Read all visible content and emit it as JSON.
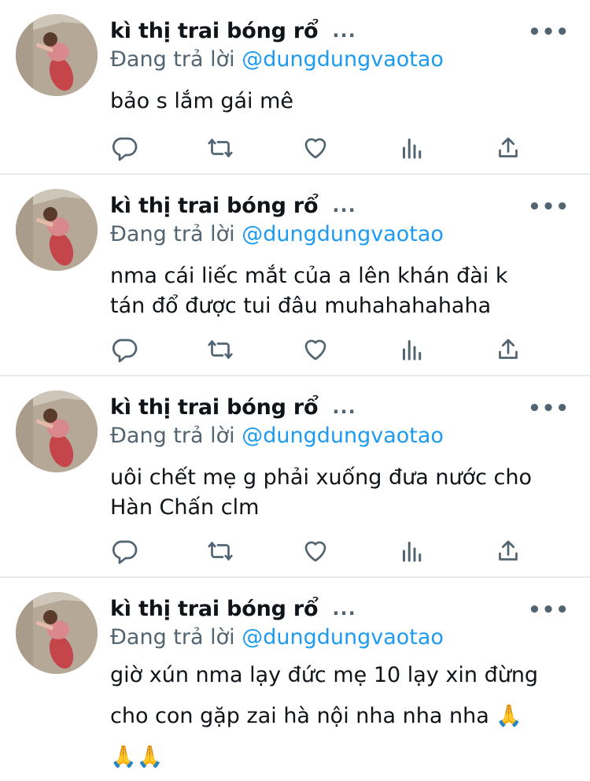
{
  "tweets": [
    {
      "name": "kì thị trai bóng rổ",
      "name_dots": "...",
      "more": "•••",
      "reply_prefix": "Đang trả lời",
      "reply_handle": "@dungdungvaotao",
      "lines": [
        "bảo s lắm gái mê"
      ]
    },
    {
      "name": "kì thị trai bóng rổ",
      "name_dots": "...",
      "more": "•••",
      "reply_prefix": "Đang trả lời",
      "reply_handle": "@dungdungvaotao",
      "lines": [
        "nma cái liếc mắt của a lên khán đài k",
        "tán đổ được tui đâu muhahahahaha"
      ]
    },
    {
      "name": "kì thị trai bóng rổ",
      "name_dots": "...",
      "more": "•••",
      "reply_prefix": "Đang trả lời",
      "reply_handle": "@dungdungvaotao",
      "lines": [
        "uôi chết mẹ g phải xuống đưa nước cho",
        "Hàn Chấn clm"
      ]
    },
    {
      "name": "kì thị trai bóng rổ",
      "name_dots": "...",
      "more": "•••",
      "reply_prefix": "Đang trả lời",
      "reply_handle": "@dungdungvaotao",
      "lines": [
        "giờ xún nma lạy đức mẹ 10 lạy xin đừng",
        "cho con gặp zai hà nội nha nha nha 🙏",
        "🙏🙏"
      ]
    }
  ],
  "icons": [
    "reply-icon",
    "retweet-icon",
    "like-icon",
    "analytics-icon",
    "share-icon"
  ],
  "colors": {
    "text": "#0f1419",
    "secondary": "#536471",
    "link": "#1d9bf0",
    "divider": "#e6ecf0"
  }
}
